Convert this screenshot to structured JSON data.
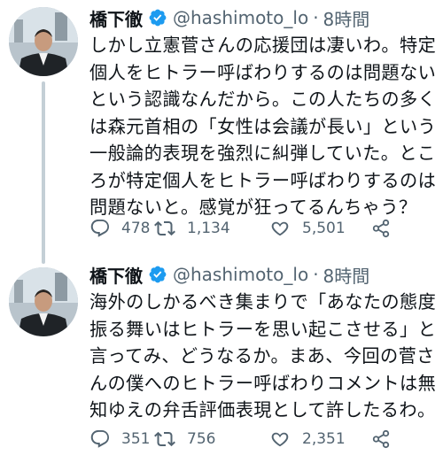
{
  "tweets": [
    {
      "author": {
        "name": "橋下徹",
        "handle": "@hashimoto_lo",
        "separator": "·",
        "time": "8時間",
        "verified": true
      },
      "lines": [
        "しかし立憲菅さんの応援団は凄いわ。特定",
        "個人をヒトラー呼ばわりするのは問題ない",
        "という認識なんだから。この人たちの多く",
        "は森元首相の「女性は会議が長い」という",
        "一般論的表現を強烈に糾弾していた。とこ",
        "ろが特定個人をヒトラー呼ばわりするのは",
        "問題ないと。感覚が狂ってるんちゃう？"
      ],
      "actions": {
        "replies": "478",
        "retweets": "1,134",
        "likes": "5,501"
      }
    },
    {
      "author": {
        "name": "橋下徹",
        "handle": "@hashimoto_lo",
        "separator": "·",
        "time": "8時間",
        "verified": true
      },
      "lines": [
        "海外のしかるべき集まりで「あなたの態度",
        "振る舞いはヒトラーを思い起こさせる」と",
        "言ってみ、どうなるか。まあ、今回の菅さ",
        "んの僕へのヒトラー呼ばわりコメントは無",
        "知ゆえの弁舌評価表現として許したるわ。"
      ],
      "actions": {
        "replies": "351",
        "retweets": "756",
        "likes": "2,351"
      }
    }
  ],
  "colors": {
    "text": "#0f1419",
    "secondary": "#536471",
    "verified": "#1d9bf0",
    "thread_line": "#c4cfd6"
  },
  "icons": [
    "verified-badge-icon",
    "reply-icon",
    "retweet-icon",
    "like-icon",
    "share-icon"
  ]
}
